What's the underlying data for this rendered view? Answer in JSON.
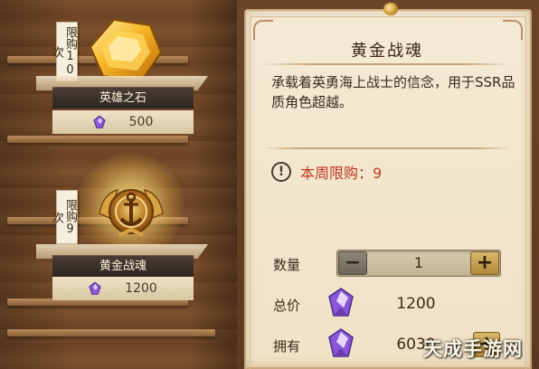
{
  "shop_items": [
    {
      "limit_label": "限购10次",
      "name": "英雄之石",
      "price": "500"
    },
    {
      "limit_label": "限购9次",
      "name": "黄金战魂",
      "price": "1200"
    }
  ],
  "detail": {
    "title": "黄金战魂",
    "description": "承载着英勇海上战士的信念，用于SSR品质角色超越。",
    "weekly_limit": "本周限购：9",
    "quantity_label": "数量",
    "quantity_value": "1",
    "total_label": "总价",
    "total_value": "1200",
    "owned_label": "拥有",
    "owned_value": "6030"
  },
  "icons": {
    "currency": "purple-crystal-icon",
    "minus": "minus-icon",
    "plus": "plus-icon",
    "warning": "exclamation-circle-icon"
  },
  "watermark": "天成手游网",
  "colors": {
    "limit_text": "#c0381f",
    "panel_bg": "#f5ead4",
    "plus_button": "#d9b96a"
  }
}
